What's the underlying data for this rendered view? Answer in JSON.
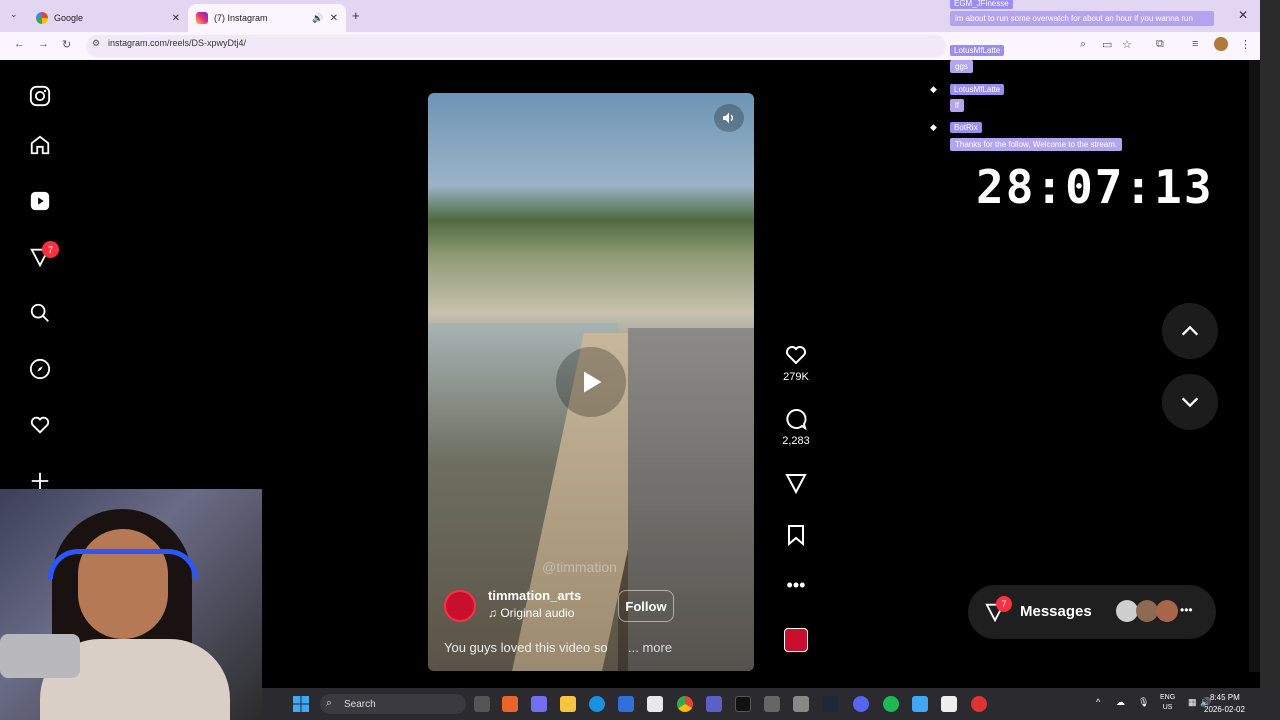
{
  "browser": {
    "tabs": [
      {
        "label": "Google",
        "active": false
      },
      {
        "label": "(7) Instagram",
        "active": true
      }
    ],
    "url": "instagram.com/reels/DS-xpwyDtj4/"
  },
  "sidebar": {
    "notification_count": "7"
  },
  "reel": {
    "watermark": "@timmation",
    "author": "timmation_arts",
    "audio": "Original audio",
    "follow_label": "Follow",
    "caption": "You guys loved this video so",
    "more_label": "... more",
    "likes": "279K",
    "comments": "2,283"
  },
  "messages": {
    "label": "Messages",
    "badge": "7"
  },
  "overlay": {
    "chat": [
      {
        "user": "EGM_JFinesse",
        "message": "im about to run some overwatch for about an hour if you wanna run"
      },
      {
        "user": "LotusMfLatte",
        "message": "ggs"
      },
      {
        "user": "LotusMfLatte",
        "message": "lf"
      },
      {
        "user": "BotRix",
        "message": "Thanks for the follow, Welcome to the stream."
      }
    ],
    "timer": "28:07:13"
  },
  "taskbar": {
    "search_label": "Search",
    "lang_top": "ENG",
    "lang_bottom": "US",
    "time": "8:45 PM",
    "date": "2026-02-02"
  },
  "colors": {
    "accent_red": "#ff3040",
    "tabstrip": "#e3d6f3",
    "chat_bubble": "#b3a4ee"
  }
}
